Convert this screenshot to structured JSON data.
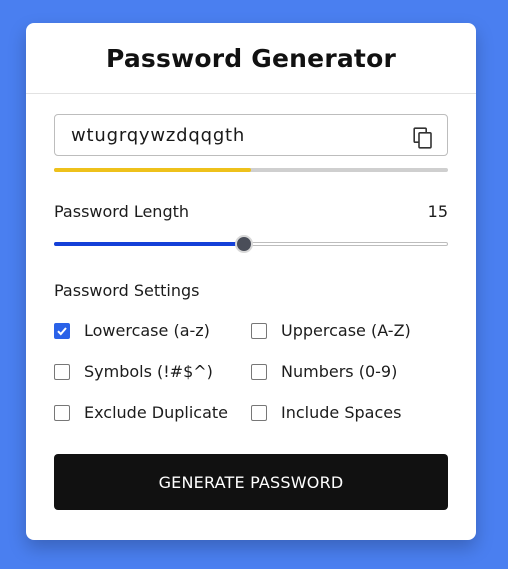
{
  "app": {
    "title": "Password Generator"
  },
  "password": {
    "value": "wtugrqywzdqqgth",
    "strength_fraction": 0.5,
    "strength_color": "#eec11b"
  },
  "length": {
    "label": "Password Length",
    "value": "15",
    "min": 1,
    "max": 30,
    "current": 15
  },
  "settings": {
    "label": "Password Settings",
    "options": [
      {
        "label": "Lowercase (a-z)",
        "checked": true
      },
      {
        "label": "Uppercase (A-Z)",
        "checked": false
      },
      {
        "label": "Symbols (!#$^)",
        "checked": false
      },
      {
        "label": "Numbers (0-9)",
        "checked": false
      },
      {
        "label": "Exclude Duplicate",
        "checked": false
      },
      {
        "label": "Include Spaces",
        "checked": false
      }
    ]
  },
  "actions": {
    "generate_label": "GENERATE PASSWORD"
  },
  "colors": {
    "background": "#4a7ff0",
    "accent": "#1440d8",
    "checkbox": "#2a62e8",
    "button": "#111111"
  },
  "icons": {
    "copy": "copy-icon",
    "check": "check-icon"
  }
}
